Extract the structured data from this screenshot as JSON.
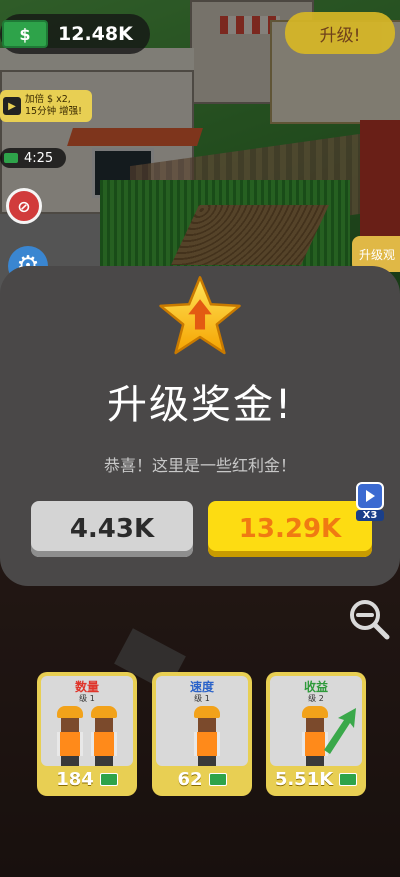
{
  "hud": {
    "cash_symbol": "$",
    "cash_amount": "12.48K",
    "upgrade_button": "升级!",
    "boost_line1": "加倍 $ x2,",
    "boost_line2": "15分钟 增强!",
    "timer": "4:25",
    "side_tag": "升级观"
  },
  "modal": {
    "title": "升级奖金!",
    "subtitle": "恭喜！这里是一些红利金！",
    "claim_amount": "4.43K",
    "claim_x3_amount": "13.29K",
    "video_multiplier": "X3"
  },
  "cards": [
    {
      "title": "数量",
      "level": "级 1",
      "price": "184",
      "title_color": "#e0342a"
    },
    {
      "title": "速度",
      "level": "级 1",
      "price": "62",
      "title_color": "#2b63c9"
    },
    {
      "title": "收益",
      "level": "级 2",
      "price": "5.51K",
      "title_color": "#2e9a3a"
    }
  ],
  "colors": {
    "accent_yellow": "#fddc12",
    "accent_orange": "#f07a12",
    "panel_bg": "#4a4848"
  }
}
